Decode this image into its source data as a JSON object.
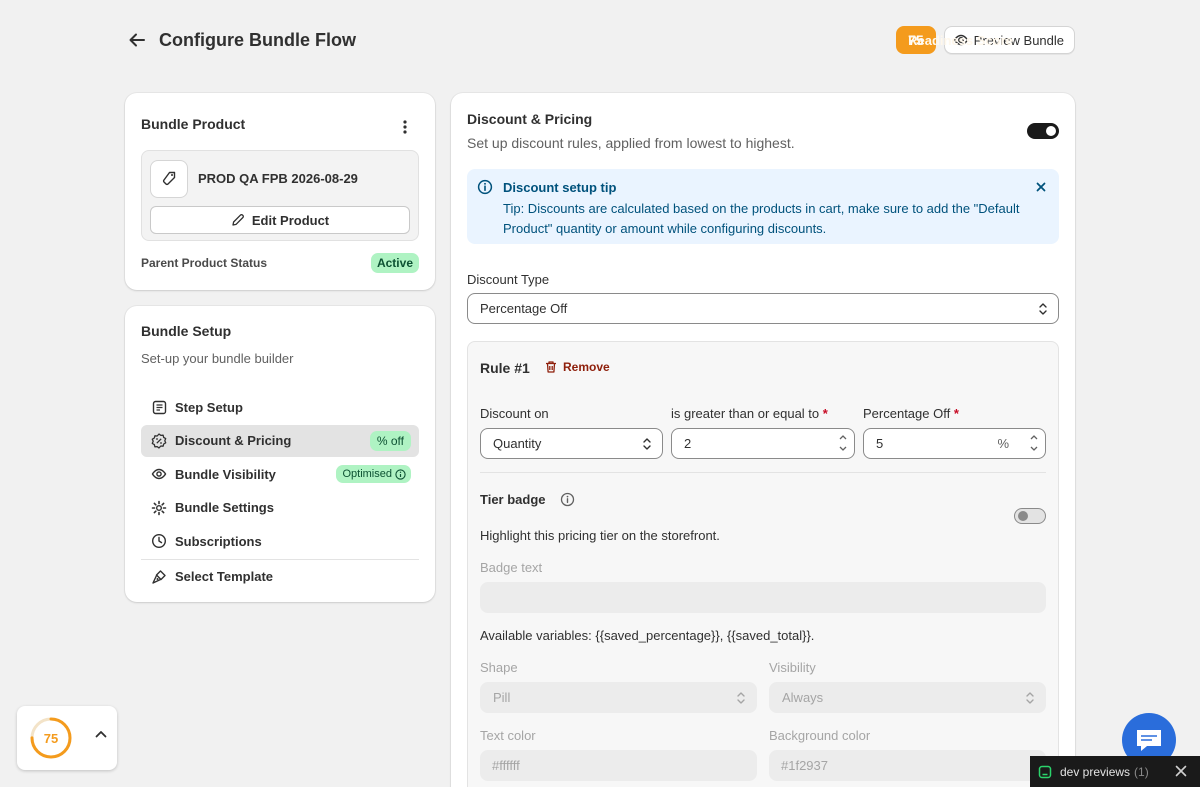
{
  "header": {
    "title": "Configure Bundle Flow",
    "readiness_score": "75",
    "readiness_label": "Readiness Score",
    "preview_label": "Preview Bundle"
  },
  "bundle_product": {
    "title": "Bundle Product",
    "product_name": "PROD QA FPB 2026-08-29",
    "edit_label": "Edit Product",
    "status_label": "Parent Product Status",
    "status_value": "Active"
  },
  "bundle_setup": {
    "title": "Bundle Setup",
    "subtitle": "Set-up your bundle builder",
    "items": [
      {
        "label": "Step Setup",
        "icon": "list-icon"
      },
      {
        "label": "Discount & Pricing",
        "icon": "discount-icon",
        "tag": "% off",
        "selected": true
      },
      {
        "label": "Bundle Visibility",
        "icon": "eye-icon",
        "tag": "Optimised"
      },
      {
        "label": "Bundle Settings",
        "icon": "gear-icon"
      },
      {
        "label": "Subscriptions",
        "icon": "clock-icon"
      },
      {
        "label": "Select Template",
        "icon": "paint-icon"
      }
    ]
  },
  "discount": {
    "title": "Discount & Pricing",
    "subtitle": "Set up discount rules, applied from lowest to highest.",
    "enabled": true,
    "tip_title": "Discount setup tip",
    "tip_body": "Tip: Discounts are calculated based on the products in cart, make sure to add the \"Default Product\" quantity or amount while configuring discounts.",
    "type_label": "Discount Type",
    "type_value": "Percentage Off",
    "rule": {
      "title": "Rule #1",
      "remove_label": "Remove",
      "discount_on_label": "Discount on",
      "discount_on_value": "Quantity",
      "condition_label": "is greater than or equal to",
      "condition_value": "2",
      "percentage_label": "Percentage Off",
      "percentage_value": "5",
      "percentage_suffix": "%",
      "required_mark": "*",
      "tier_badge_label": "Tier badge",
      "tier_badge_enabled": false,
      "tier_badge_sub": "Highlight this pricing tier on the storefront.",
      "badge_text_label": "Badge text",
      "badge_text_value": "",
      "variables_text": "Available variables: {{saved_percentage}}, {{saved_total}}.",
      "shape_label": "Shape",
      "shape_value": "Pill",
      "visibility_label": "Visibility",
      "visibility_value": "Always",
      "text_color_label": "Text color",
      "text_color_value": "#ffffff",
      "bg_color_label": "Background color",
      "bg_color_value": "#1f2937"
    }
  },
  "score_widget": {
    "value": "75",
    "fraction": 0.75
  },
  "dev_bar": {
    "label": "dev previews",
    "count": "(1)"
  },
  "colors": {
    "accent": "#f49b1d",
    "tip_bg": "#eaf4ff",
    "success_bg": "#aff3c3",
    "dark": "#1a1a1a"
  }
}
